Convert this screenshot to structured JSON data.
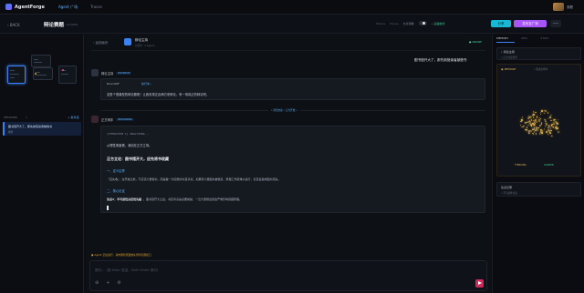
{
  "app": {
    "name": "AgentForge"
  },
  "nav": {
    "tab_plaza": "Agent 广场",
    "tab_traces": "Traces"
  },
  "user": {
    "name": "观看"
  },
  "subbar": {
    "back": "BACK",
    "title": "辩论赛题",
    "sub": "• LOADED",
    "tokens": "Tokens",
    "traces": "Traces",
    "toggle_label": "允许观看",
    "link_green": "• 演进模式",
    "share": "分享",
    "primary": "发布至广场",
    "more": "•••"
  },
  "left": {
    "section_label": "SESSIONS",
    "section_count": "1",
    "section_add": "+ 新对话",
    "session_title": "图书馆开大了，那先前馆读者被借书",
    "session_time": "刚刚"
  },
  "conversation": {
    "back": "‹ 返回画布",
    "agent_name": "辩论主持",
    "agent_sub": "对话中 · 2 agents",
    "status": "● ONLINE",
    "user_message": "图书馆开大了，那先前馆读者被借书",
    "msg1": {
      "name": "辩论主持",
      "tag": "ROUNDUP",
      "quote_head": "Roundoff",
      "quote_tag": "执行中...",
      "body": "这是个很典型的辩论题呢！让我安排正反两方来辩论，来一场真正的辩论吧。"
    },
    "divider": "• 辩论交接 • 正方开始 •",
    "msg2": {
      "name": "正方辩手",
      "tag": "REASONING",
      "iter_line": "[ITERATION 1] ANALYZING...",
      "intro": "从理性角度看，我站在正方立场。",
      "heading": "正方立论：图书馆开大，应先将书收藏",
      "sec1": "一、定义边界",
      "sec1_body": "「应先收」：在开放之前，不应该大量借书，而是做一次完整的书目清点。如果有大量图书被借走，整理工作就难以进行，甚至会造成图书流失。",
      "sec2": "二、核心论证",
      "sec2_body_bold": "论点1：不可逆性决定优先级",
      "sec2_body": "。图书馆开大之后，书目清点是必要前提，一旦大量借出就会严重影响馆藏整理。"
    },
    "warn": "● Agent 正在运行，请勿刷新页面或关闭浏览器窗口",
    "composer_placeholder": "提问…（按 Enter 发送，Shift+Enter 换行）"
  },
  "right": {
    "tab1": "MEMORY",
    "tab2": "IDEA",
    "tab3": "STATS",
    "card1_title": "• 辩论主持",
    "card1_line": "• 正方立论辩手",
    "card2_title": "◉ MEMORY",
    "card2_tag": "• 陈述立场中",
    "status_left": "THINKING",
    "status_right": "LOADED",
    "card3_title": "论点记录",
    "card3_line": "• 不可逆性论证"
  },
  "colors": {
    "accent": "#3b82f6",
    "share": "#16b8d6",
    "primary": "#a855f7",
    "send": "#d1285a",
    "brain": "#e0b24c"
  }
}
